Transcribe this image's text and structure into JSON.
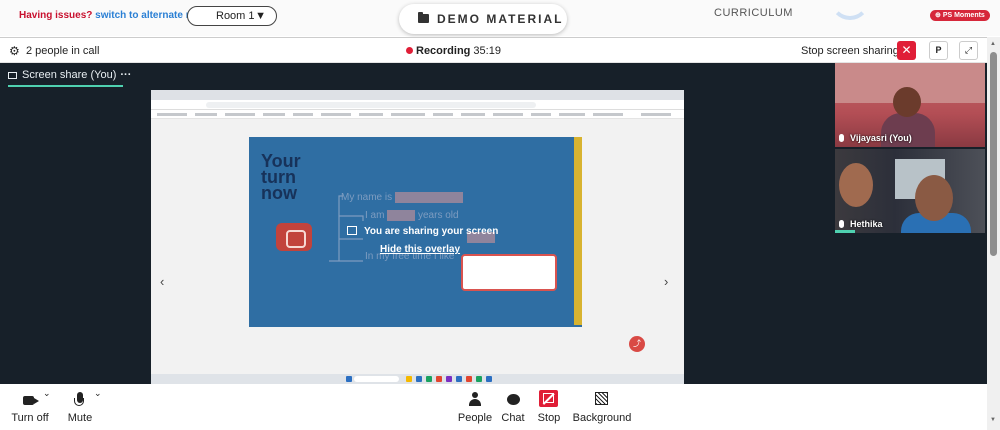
{
  "topbar": {
    "issue_text": "Having issues?",
    "issue_link": "switch to alternate room",
    "room_select": "Room 1",
    "demo_material": "DEMO MATERIAL",
    "curriculum": "CURRICULUM",
    "moments_badge": "PS Moments"
  },
  "callbar": {
    "people_count": "2 people in call",
    "recording_label": "Recording",
    "recording_time": "35:19",
    "stop_screen_sharing": "Stop screen sharing",
    "p_button": "P"
  },
  "stage": {
    "share_tab": "Screen share (You)",
    "overlay_title": "You are sharing your screen",
    "overlay_link": "Hide this overlay"
  },
  "slide": {
    "title_lines": [
      "Your",
      "turn",
      "now"
    ],
    "prompts": [
      "My name is",
      "I am",
      "years old",
      "In my free time I like"
    ]
  },
  "participants": [
    {
      "name": "Vijayasri (You)"
    },
    {
      "name": "Hethika"
    }
  ],
  "bottombar": {
    "turn_off": "Turn off",
    "mute": "Mute",
    "people": "People",
    "chat": "Chat",
    "stop": "Stop",
    "background": "Background"
  },
  "colors": {
    "accent_red": "#e01e37",
    "teal": "#4fd1b0",
    "stage_bg": "#172029",
    "slide_blue": "#2f6ea3"
  },
  "icons": [
    "gear-icon",
    "folder-icon",
    "close-icon",
    "fullscreen-icon",
    "monitor-icon",
    "more-icon",
    "upload-icon",
    "camera-icon",
    "microphone-icon",
    "people-icon",
    "chat-icon",
    "stop-share-icon",
    "background-icon",
    "chevron-down-icon",
    "share-icon"
  ]
}
